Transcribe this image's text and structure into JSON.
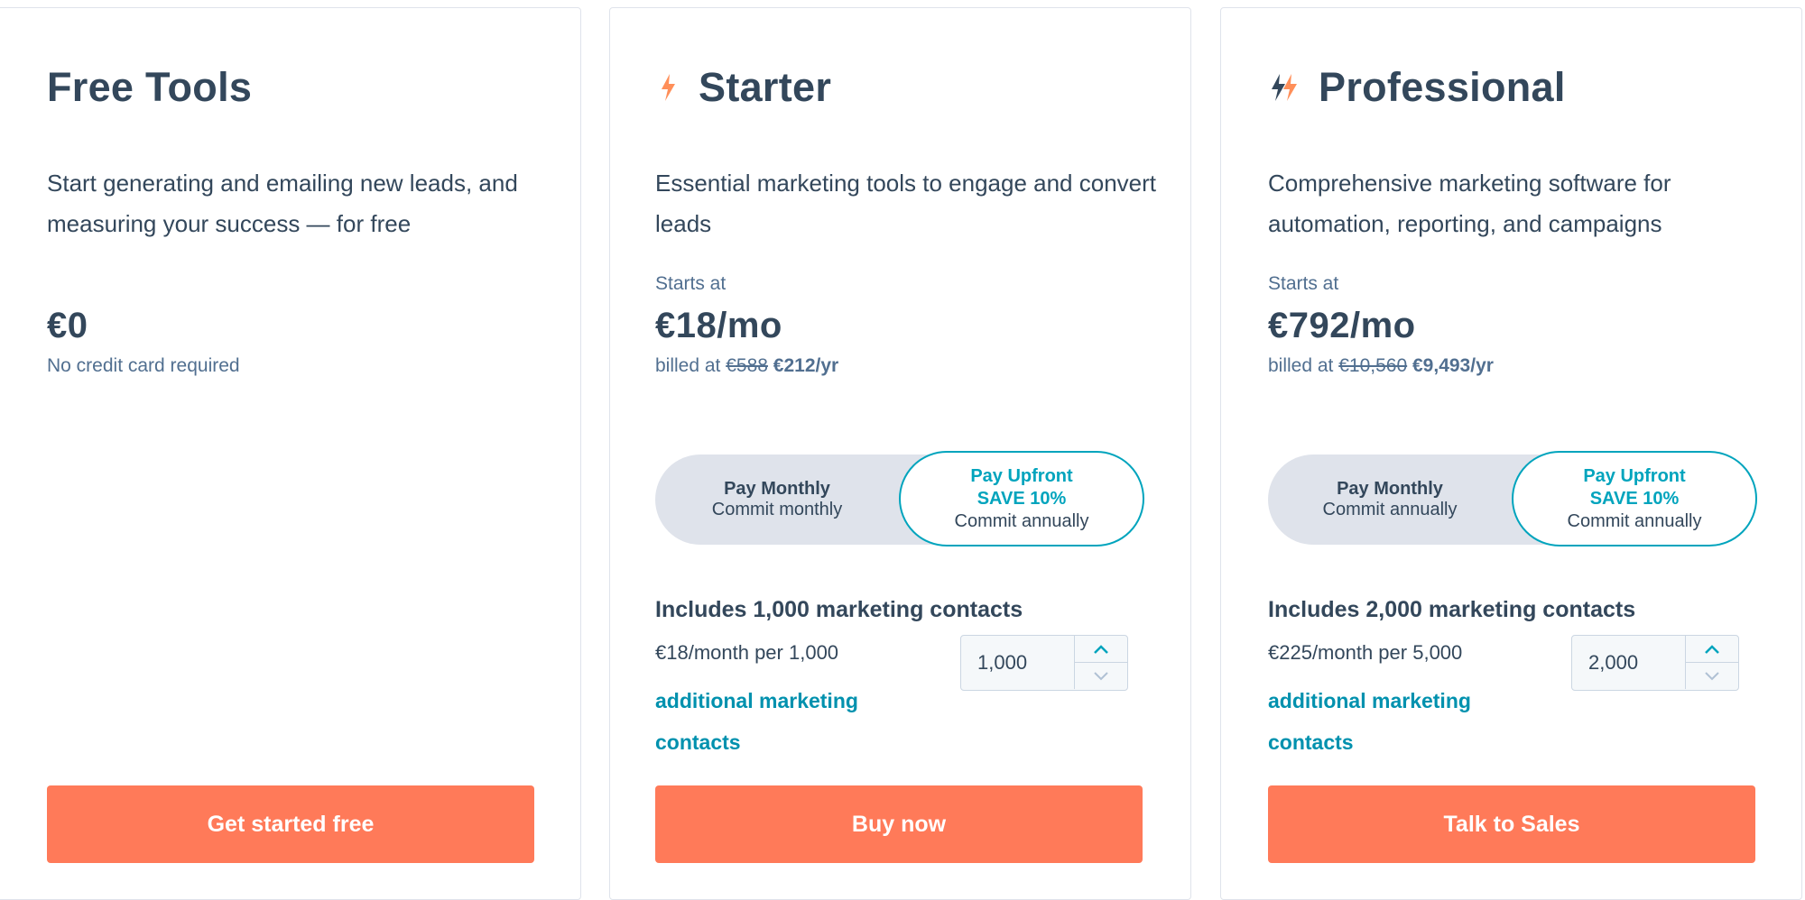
{
  "plans": {
    "free": {
      "title": "Free Tools",
      "description": "Start generating and emailing new leads, and measuring your success — for free",
      "price": "€0",
      "price_note": "No credit card required",
      "cta": "Get started free"
    },
    "starter": {
      "title": "Starter",
      "icon": "starter-bolt-icon",
      "description": "Essential marketing tools to engage and convert leads",
      "starts_at": "Starts at",
      "price": "€18/mo",
      "billed_prefix": "billed at",
      "billed_old": "€588",
      "billed_new": "€212/yr",
      "toggle": {
        "left_title": "Pay Monthly",
        "left_sub": "Commit monthly",
        "right_title": "Pay Upfront",
        "right_save": "SAVE 10%",
        "right_sub": "Commit annually"
      },
      "includes": "Includes 1,000 marketing contacts",
      "per_rate": "€18/month per 1,000",
      "add_link": "additional marketing contacts",
      "stepper_value": "1,000",
      "cta": "Buy now"
    },
    "pro": {
      "title": "Professional",
      "icon": "professional-bolt-icon",
      "description": "Comprehensive marketing software for automation, reporting, and campaigns",
      "starts_at": "Starts at",
      "price": "€792/mo",
      "billed_prefix": "billed at",
      "billed_old": "€10,560",
      "billed_new": "€9,493/yr",
      "toggle": {
        "left_title": "Pay Monthly",
        "left_sub": "Commit annually",
        "right_title": "Pay Upfront",
        "right_save": "SAVE 10%",
        "right_sub": "Commit annually"
      },
      "includes": "Includes 2,000 marketing contacts",
      "per_rate": "€225/month per 5,000",
      "add_link": "additional marketing contacts",
      "stepper_value": "2,000",
      "cta": "Talk to Sales"
    }
  },
  "colors": {
    "accent": "#ff7a59",
    "teal": "#00a4bd",
    "text": "#33475b",
    "muted": "#516f90",
    "toggle_bg": "#dfe3eb"
  }
}
